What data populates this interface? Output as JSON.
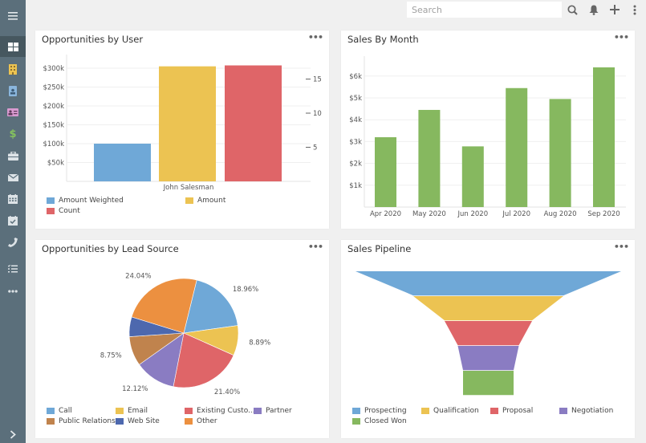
{
  "sidebar": {
    "items": [
      {
        "name": "menu-toggle",
        "icon": "hamburger-icon"
      },
      {
        "name": "dashboard",
        "icon": "dashboard-icon",
        "active": true,
        "color": "#ffffff"
      },
      {
        "name": "accounts",
        "icon": "building-icon",
        "color": "#ecc351"
      },
      {
        "name": "contacts",
        "icon": "contact-badge-icon",
        "color": "#8ab6dd"
      },
      {
        "name": "leads",
        "icon": "id-card-icon",
        "color": "#d99ad0"
      },
      {
        "name": "opportunities",
        "icon": "dollar-icon",
        "color": "#85c25e"
      },
      {
        "name": "cases",
        "icon": "briefcase-icon",
        "color": "#dde3e7"
      },
      {
        "name": "email",
        "icon": "envelope-icon",
        "color": "#dde3e7"
      },
      {
        "name": "calendar",
        "icon": "calendar-icon",
        "color": "#dde3e7"
      },
      {
        "name": "meetings",
        "icon": "calendar-check-icon",
        "color": "#dde3e7"
      },
      {
        "name": "calls",
        "icon": "phone-icon",
        "color": "#dde3e7"
      },
      {
        "name": "tasks",
        "icon": "task-list-icon",
        "color": "#dde3e7"
      },
      {
        "name": "more",
        "icon": "more-horizontal-icon",
        "color": "#dde3e7"
      }
    ],
    "expand_icon": "chevron-right-icon"
  },
  "topbar": {
    "search_placeholder": "Search",
    "search_value": "",
    "icons": [
      "search-icon",
      "bell-icon",
      "plus-icon",
      "more-vertical-icon"
    ]
  },
  "cards": {
    "opps_by_user": {
      "title": "Opportunities by User",
      "menu": "•••"
    },
    "sales_by_month": {
      "title": "Sales By Month",
      "menu": "•••"
    },
    "opps_by_lead_source": {
      "title": "Opportunities by Lead Source",
      "menu": "•••"
    },
    "sales_pipeline": {
      "title": "Sales Pipeline",
      "menu": "•••"
    }
  },
  "chart_data": [
    {
      "id": "opps_by_user",
      "type": "bar",
      "title": "Opportunities by User",
      "categories": [
        "John Salesman"
      ],
      "series": [
        {
          "name": "Amount Weighted",
          "values": [
            100000
          ],
          "axis": "left",
          "color": "#6fa8d7"
        },
        {
          "name": "Amount",
          "values": [
            305000
          ],
          "axis": "left",
          "color": "#ecc352"
        },
        {
          "name": "Count",
          "values": [
            17
          ],
          "axis": "right",
          "color": "#df6568"
        }
      ],
      "y_left": {
        "ticks": [
          "$50k",
          "$100k",
          "$150k",
          "$200k",
          "$250k",
          "$300k"
        ],
        "tick_values": [
          50000,
          100000,
          150000,
          200000,
          250000,
          300000
        ],
        "range": [
          0,
          300000
        ]
      },
      "y_right": {
        "ticks": [
          "5",
          "10",
          "15"
        ],
        "tick_values": [
          5,
          10,
          15
        ],
        "range": [
          0,
          15
        ]
      },
      "grid": true,
      "legend": "bottom"
    },
    {
      "id": "sales_by_month",
      "type": "bar",
      "title": "Sales By Month",
      "categories": [
        "Apr 2020",
        "May 2020",
        "Jun 2020",
        "Jul 2020",
        "Aug 2020",
        "Sep 2020"
      ],
      "values": [
        3200,
        4450,
        2780,
        5450,
        4950,
        6400
      ],
      "color": "#86b85f",
      "y": {
        "ticks": [
          "$1k",
          "$2k",
          "$3k",
          "$4k",
          "$5k",
          "$6k"
        ],
        "tick_values": [
          1000,
          2000,
          3000,
          4000,
          5000,
          6000
        ],
        "range": [
          0,
          6000
        ]
      },
      "grid": true,
      "legend": "none"
    },
    {
      "id": "opps_by_lead_source",
      "type": "pie",
      "title": "Opportunities by Lead Source",
      "slices": [
        {
          "label": "Call",
          "value": 18.96,
          "display": "18.96%",
          "color": "#6fa8d7"
        },
        {
          "label": "Email",
          "value": 8.89,
          "display": "8.89%",
          "color": "#ecc352"
        },
        {
          "label": "Existing Custo...",
          "value": 21.4,
          "display": "21.40%",
          "color": "#df6568"
        },
        {
          "label": "Partner",
          "value": 12.12,
          "display": "12.12%",
          "color": "#8a7cc2"
        },
        {
          "label": "Public Relations",
          "value": 8.75,
          "display": "8.75%",
          "color": "#c0834d"
        },
        {
          "label": "Web Site",
          "value": 5.84,
          "display": "",
          "color": "#4d68ae"
        },
        {
          "label": "Other",
          "value": 24.04,
          "display": "24.04%",
          "color": "#ec9040"
        }
      ],
      "legend": "bottom"
    },
    {
      "id": "sales_pipeline",
      "type": "funnel",
      "title": "Sales Pipeline",
      "stages": [
        {
          "label": "Prospecting",
          "value": 331,
          "color": "#6fa8d7"
        },
        {
          "label": "Qualification",
          "value": 187,
          "color": "#ecc352"
        },
        {
          "label": "Proposal",
          "value": 109,
          "color": "#df6568"
        },
        {
          "label": "Negotiation",
          "value": 76,
          "color": "#8a7cc2"
        },
        {
          "label": "Closed Won",
          "value": 63,
          "color": "#86b85f"
        }
      ],
      "legend": "bottom"
    }
  ]
}
